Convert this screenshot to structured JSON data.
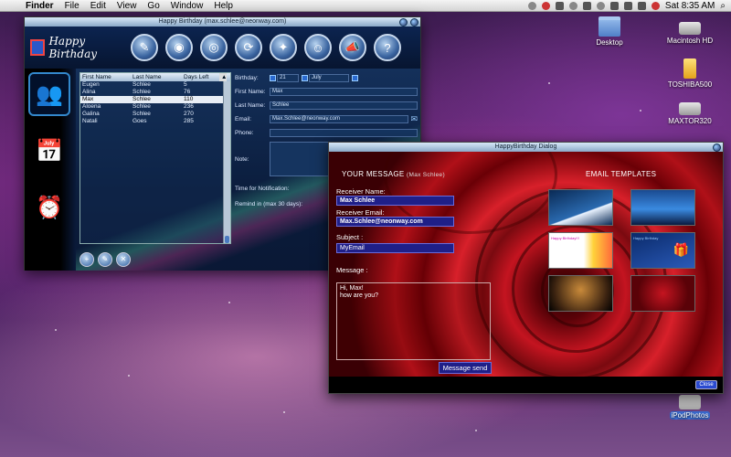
{
  "menubar": {
    "app_name": "Finder",
    "menus": [
      "File",
      "Edit",
      "View",
      "Go",
      "Window",
      "Help"
    ],
    "clock": "Sat 8:35 AM"
  },
  "desktop_icons": [
    {
      "label": "Desktop",
      "type": "folder"
    },
    {
      "label": "Macintosh HD",
      "type": "hd"
    },
    {
      "label": "TOSHIBA500",
      "type": "usb"
    },
    {
      "label": "MAXTOR320",
      "type": "hd"
    },
    {
      "label": "iPodPhotos",
      "type": "ipod"
    }
  ],
  "main_window": {
    "title": "Happy Birthday (max.schlee@neonway.com)",
    "logo_text": "Happy Birthday",
    "toolbar_icons": [
      "address-book-icon",
      "camera-icon",
      "globe-icon",
      "sync-icon",
      "web-icon",
      "user-icon",
      "megaphone-icon",
      "help-icon"
    ],
    "sidebar": [
      {
        "name": "contacts-icon",
        "glyph": "👥"
      },
      {
        "name": "calendar-icon",
        "glyph": "📅"
      },
      {
        "name": "alarm-clock-icon",
        "glyph": "⏰"
      }
    ],
    "list": {
      "headers": [
        "First Name",
        "Last Name",
        "Days Left"
      ],
      "rows": [
        [
          "Eugen",
          "Schlee",
          "5"
        ],
        [
          "Alina",
          "Schlee",
          "76"
        ],
        [
          "Max",
          "Schlee",
          "110"
        ],
        [
          "Aloena",
          "Schlee",
          "236"
        ],
        [
          "Galina",
          "Schlee",
          "270"
        ],
        [
          "Natali",
          "Goes",
          "285"
        ]
      ],
      "selected_index": 2
    },
    "form": {
      "birthday_label": "Birthday:",
      "birthday_day": "21",
      "birthday_month": "July",
      "first_name_label": "First Name:",
      "first_name": "Max",
      "last_name_label": "Last Name:",
      "last_name": "Schlee",
      "email_label": "Email:",
      "email": "Max.Schlee@neonway.com",
      "phone_label": "Phone:",
      "phone": "",
      "note_label": "Note:",
      "time_label": "Time for Notification:",
      "remind_label": "Remind in (max 30 days):"
    }
  },
  "dialog": {
    "title": "HappyBirthday Dialog",
    "your_message": "YOUR MESSAGE",
    "your_message_sub": "(Max Schlee)",
    "templates_heading": "EMAIL TEMPLATES",
    "receiver_name_label": "Receiver Name:",
    "receiver_name": "Max Schlee",
    "receiver_email_label": "Receiver Email:",
    "receiver_email": "Max.Schlee@neonway.com",
    "subject_label": "Subject :",
    "subject": "MyEmail",
    "message_label": "Message :",
    "message": "Hi, Max!\nhow are you?",
    "send_label": "Message send",
    "close_label": "Close",
    "template_1_text": "Happy Birthday!!!",
    "template_2_text": "Happy Birthday"
  },
  "colors": {
    "field_bg": "#1f1f88",
    "rose_red": "#c41420",
    "window_bg": "#0a1a33"
  }
}
